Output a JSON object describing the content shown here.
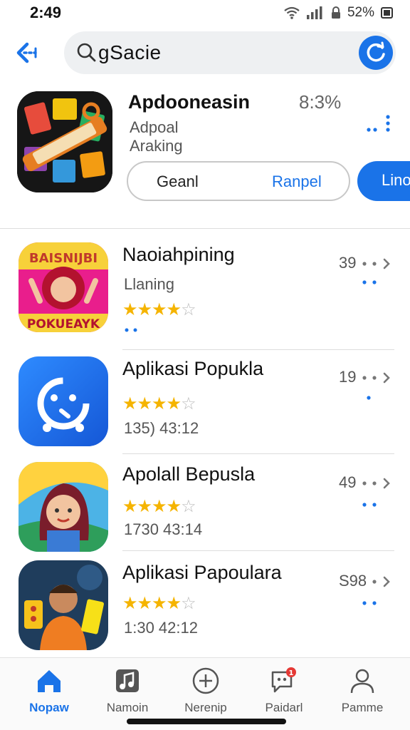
{
  "status": {
    "time": "2:49",
    "battery_pct": "52%"
  },
  "search": {
    "query": "gSacie"
  },
  "featured": {
    "title": "Apdooneasin",
    "meta": "8:3%",
    "sub1": "Adpoal",
    "sub2": "Araking",
    "btn_left": "Geanl",
    "btn_right": "Ranpel",
    "btn_filled": "Lino"
  },
  "apps": [
    {
      "name": "Naoiahpining",
      "sub": "Llaning",
      "rating": 4,
      "meta": "39"
    },
    {
      "name": "Aplikasi Popukla",
      "sub": "135) 43:12",
      "rating": 4,
      "meta": "19"
    },
    {
      "name": "Apolall Bepusla",
      "sub": "1730 43:14",
      "rating": 4,
      "meta": "49"
    },
    {
      "name": "Aplikasi Papoulara",
      "sub": "1:30 42:12",
      "rating": 4,
      "meta": "S98"
    }
  ],
  "icon_texts": {
    "app1_top": "BAISNIJBI",
    "app1_bottom": "POKUEAYK"
  },
  "nav": [
    {
      "label": "Nopaw",
      "icon": "home-icon",
      "active": true
    },
    {
      "label": "Namoin",
      "icon": "music-icon",
      "active": false
    },
    {
      "label": "Nerenip",
      "icon": "plus-icon",
      "active": false
    },
    {
      "label": "Paidarl",
      "icon": "chat-icon",
      "active": false,
      "badge": "1"
    },
    {
      "label": "Pamme",
      "icon": "profile-icon",
      "active": false
    }
  ],
  "colors": {
    "accent": "#1a73e8",
    "star": "#f5b400"
  }
}
